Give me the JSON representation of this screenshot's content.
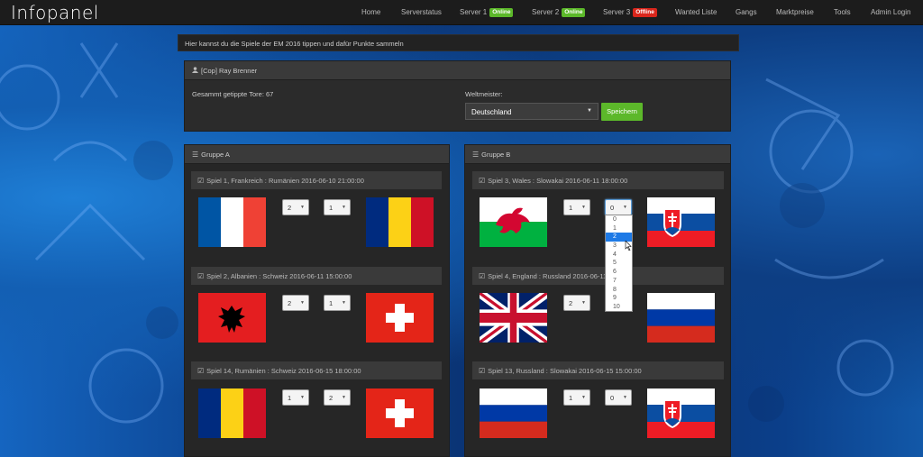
{
  "nav": {
    "brand": "Infopanel",
    "items": [
      {
        "label": "Home"
      },
      {
        "label": "Serverstatus"
      },
      {
        "label": "Server 1",
        "badge": "Online",
        "badge_color": "#5cb82a"
      },
      {
        "label": "Server 2",
        "badge": "Online",
        "badge_color": "#5cb82a"
      },
      {
        "label": "Server 3",
        "badge": "Offline",
        "badge_color": "#d9261c"
      },
      {
        "label": "Wanted Liste"
      },
      {
        "label": "Gangs"
      },
      {
        "label": "Marktpreise"
      },
      {
        "label": "Tools"
      },
      {
        "label": "Admin Login"
      }
    ]
  },
  "notice": "Hier kannst du die Spiele der EM 2016 tippen und dafür Punkte sammeln",
  "user": {
    "name": "[Cop] Ray Brenner",
    "icon": "user-icon",
    "goals_label": "Gesammt getippte Tore: 67",
    "champion_label": "Weltmeister:",
    "champion_value": "Deutschland",
    "save_label": "Speichern"
  },
  "groups": {
    "a": {
      "title": "Gruppe A",
      "icon": "list-icon",
      "matches": [
        {
          "title": "Spiel 1, Frankreich : Rumänien 2016-06-10 21:00:00",
          "home": "2",
          "away": "1",
          "home_flag": "france-flag",
          "away_flag": "romania-flag"
        },
        {
          "title": "Spiel 2, Albanien : Schweiz 2016-06-11 15:00:00",
          "home": "2",
          "away": "1",
          "home_flag": "albania-flag",
          "away_flag": "switzerland-flag"
        },
        {
          "title": "Spiel 14, Rumänien : Schweiz 2016-06-15 18:00:00",
          "home": "1",
          "away": "2",
          "home_flag": "romania-flag",
          "away_flag": "switzerland-flag"
        }
      ]
    },
    "b": {
      "title": "Gruppe B",
      "icon": "list-icon",
      "matches": [
        {
          "title": "Spiel 3, Wales : Slowakai 2016-06-11 18:00:00",
          "home": "1",
          "away": "0",
          "home_flag": "wales-flag",
          "away_flag": "slovakia-flag"
        },
        {
          "title": "Spiel 4, England : Russland 2016-06-11 2",
          "home": "2",
          "away": "",
          "home_flag": "uk-flag",
          "away_flag": "russia-flag"
        },
        {
          "title": "Spiel 13, Russland : Slowakai 2016-06-15 15:00:00",
          "home": "1",
          "away": "0",
          "home_flag": "russia-flag",
          "away_flag": "slovakia-flag"
        }
      ]
    }
  },
  "dropdown": {
    "options": [
      "0",
      "1",
      "2",
      "3",
      "4",
      "5",
      "6",
      "7",
      "8",
      "9",
      "10"
    ],
    "selected": "2"
  },
  "colors": {
    "accent_green": "#5cb82a",
    "offline_red": "#d9261c",
    "selected_blue": "#1e7ae6"
  }
}
